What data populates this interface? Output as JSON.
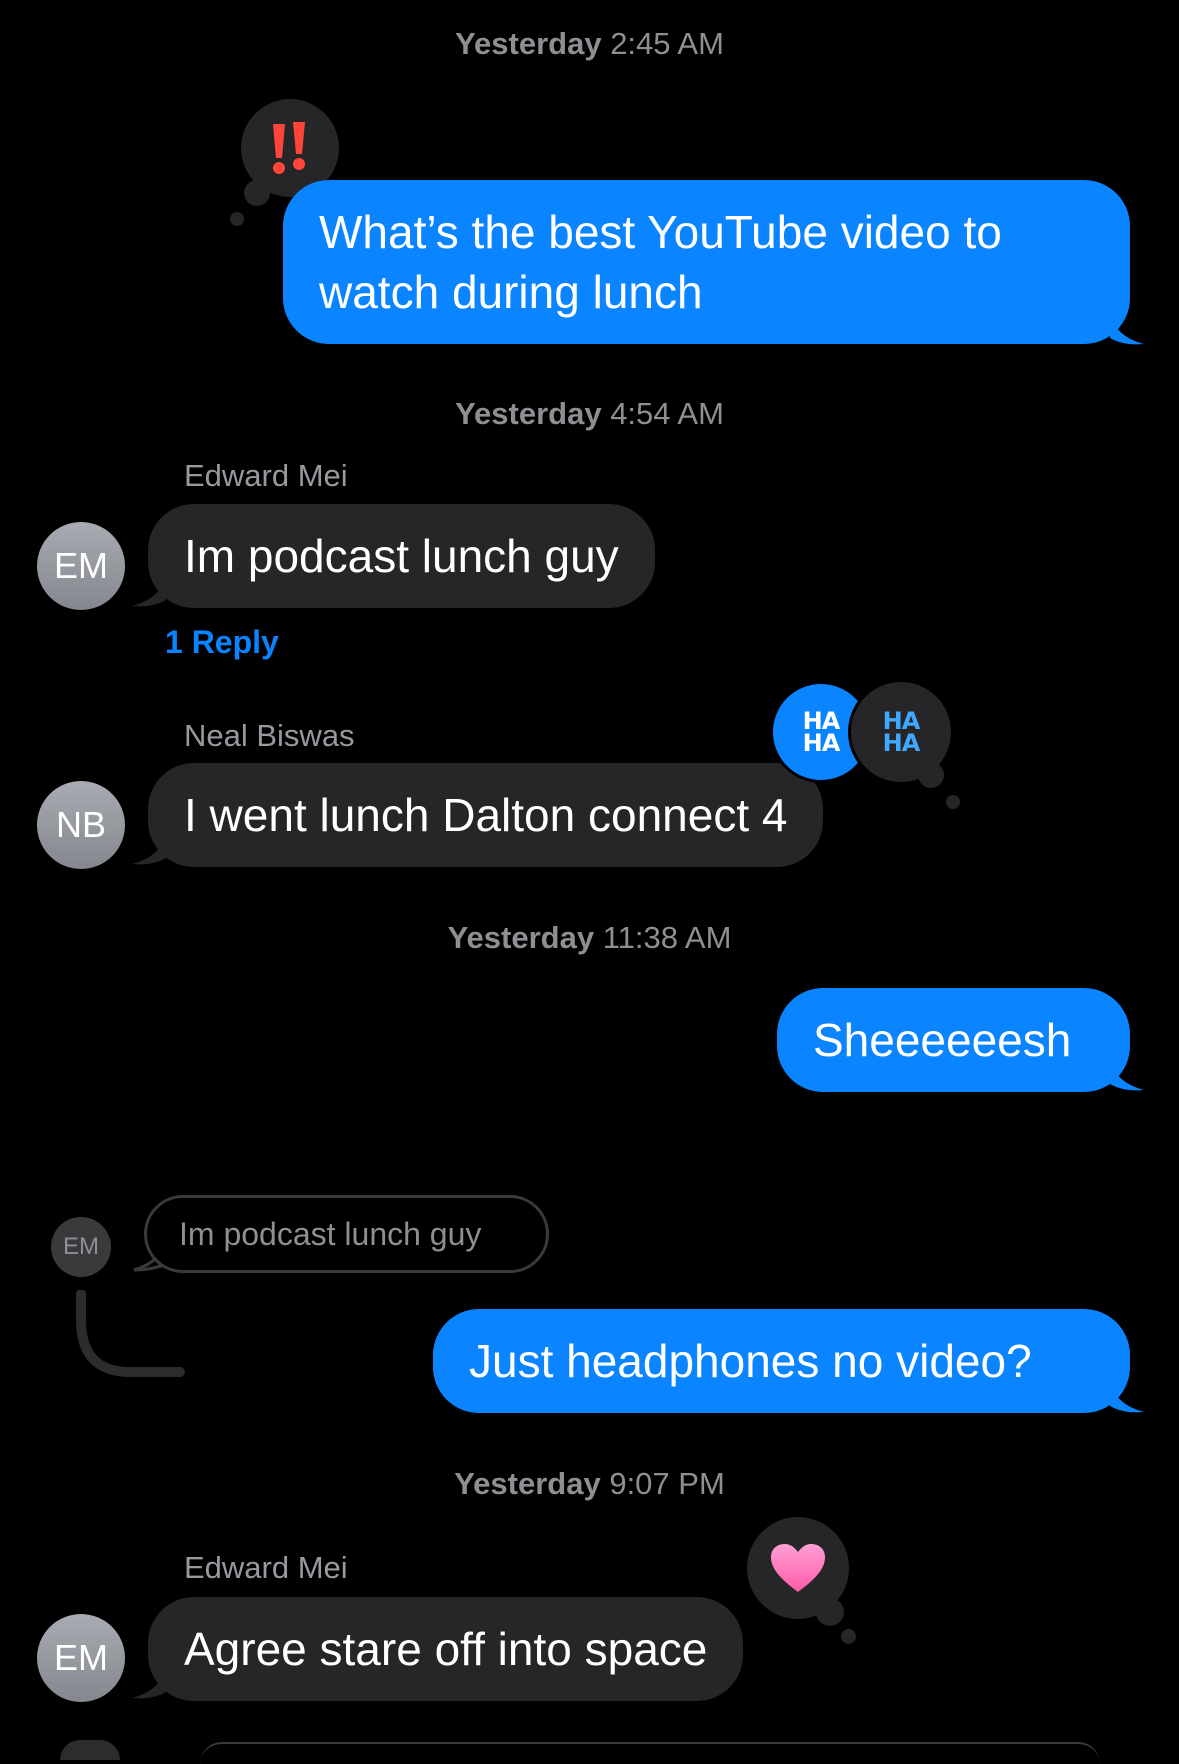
{
  "colors": {
    "background": "#000000",
    "outgoing_bubble": "#0a84ff",
    "incoming_bubble": "#262628",
    "reply_link": "#0a84ff",
    "timestamp_text": "#8e8e93"
  },
  "timestamps": [
    {
      "day": "Yesterday",
      "time": "2:45 AM"
    },
    {
      "day": "Yesterday",
      "time": "4:54 AM"
    },
    {
      "day": "Yesterday",
      "time": "11:38 AM"
    },
    {
      "day": "Yesterday",
      "time": "9:07 PM"
    }
  ],
  "messages": [
    {
      "direction": "outgoing",
      "line1": "What’s the best YouTube video to",
      "line2": "watch during lunch",
      "tapback": "exclamation-marks-icon"
    },
    {
      "direction": "incoming",
      "sender": "Edward Mei",
      "initials": "EM",
      "text": "Im podcast lunch guy",
      "reply_link": "1 Reply"
    },
    {
      "direction": "incoming",
      "sender": "Neal Biswas",
      "initials": "NB",
      "text": "I went lunch Dalton connect 4",
      "tapbacks": [
        "haha-icon",
        "haha-icon"
      ],
      "haha_top": "HA",
      "haha_bottom": "HA"
    },
    {
      "direction": "outgoing",
      "text": "Sheeeeeesh"
    },
    {
      "direction": "outgoing",
      "text": "Just headphones no video?",
      "quoted": {
        "initials": "EM",
        "text": "Im podcast lunch guy"
      }
    },
    {
      "direction": "incoming",
      "sender": "Edward Mei",
      "initials": "EM",
      "text": "Agree stare off into space",
      "tapback": "heart-icon"
    }
  ]
}
